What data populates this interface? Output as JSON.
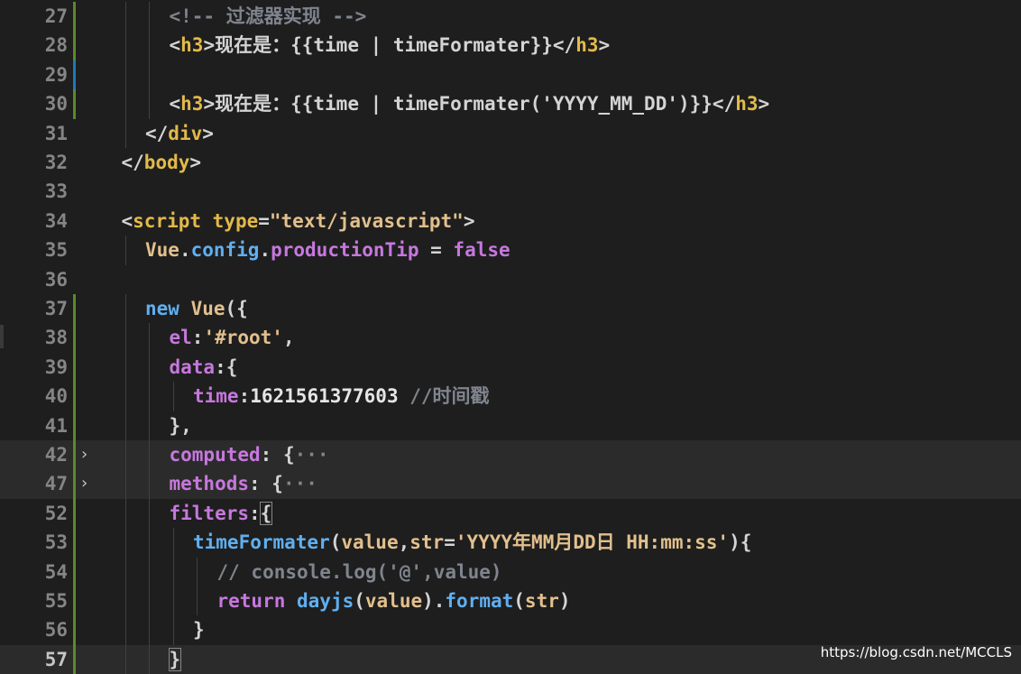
{
  "colors": {
    "background": "#1e1e1e",
    "highlight_line": "#2b2b2b",
    "line_number": "#858585",
    "tag": "#569cd6",
    "html_tag_name": "#e2b94a",
    "text": "#d4d4d4",
    "string": "#ce9178",
    "comment": "#7f848e",
    "keyword": "#569cd6",
    "property": "#c678dd",
    "number": "#b5cea8",
    "function": "#61afef"
  },
  "editor": {
    "lines": [
      {
        "num": "27",
        "indent": 3,
        "gutter": "modified",
        "tokens": [
          {
            "t": "<!-- 过滤器实现 -->",
            "c": "#7f848e"
          }
        ]
      },
      {
        "num": "28",
        "indent": 3,
        "gutter": "modified",
        "tokens": [
          {
            "t": "<",
            "c": "#d4d4d4"
          },
          {
            "t": "h3",
            "c": "#e2b94a"
          },
          {
            "t": ">",
            "c": "#d4d4d4"
          },
          {
            "t": "现在是：{{time | timeFormater}}",
            "c": "#d4d4d4"
          },
          {
            "t": "</",
            "c": "#d4d4d4"
          },
          {
            "t": "h3",
            "c": "#e2b94a"
          },
          {
            "t": ">",
            "c": "#d4d4d4"
          }
        ]
      },
      {
        "num": "29",
        "indent": 3,
        "gutter": "added",
        "tokens": []
      },
      {
        "num": "30",
        "indent": 3,
        "gutter": "modified",
        "tokens": [
          {
            "t": "<",
            "c": "#d4d4d4"
          },
          {
            "t": "h3",
            "c": "#e2b94a"
          },
          {
            "t": ">",
            "c": "#d4d4d4"
          },
          {
            "t": "现在是：{{time | timeFormater(",
            "c": "#d4d4d4"
          },
          {
            "t": "'YYYY_MM_DD'",
            "c": "#d4d4d4"
          },
          {
            "t": ")}}",
            "c": "#d4d4d4"
          },
          {
            "t": "</",
            "c": "#d4d4d4"
          },
          {
            "t": "h3",
            "c": "#e2b94a"
          },
          {
            "t": ">",
            "c": "#d4d4d4"
          }
        ]
      },
      {
        "num": "31",
        "indent": 2,
        "gutter": "",
        "tokens": [
          {
            "t": "</",
            "c": "#d4d4d4"
          },
          {
            "t": "div",
            "c": "#e2b94a"
          },
          {
            "t": ">",
            "c": "#d4d4d4"
          }
        ]
      },
      {
        "num": "32",
        "indent": 1,
        "gutter": "",
        "tokens": [
          {
            "t": "</",
            "c": "#d4d4d4"
          },
          {
            "t": "body",
            "c": "#e2b94a"
          },
          {
            "t": ">",
            "c": "#d4d4d4"
          }
        ]
      },
      {
        "num": "33",
        "indent": 0,
        "gutter": "",
        "tokens": []
      },
      {
        "num": "34",
        "indent": 1,
        "gutter": "",
        "tokens": [
          {
            "t": "<",
            "c": "#d4d4d4"
          },
          {
            "t": "script",
            "c": "#e2b94a"
          },
          {
            "t": " type",
            "c": "#e2b94a"
          },
          {
            "t": "=",
            "c": "#d4d4d4"
          },
          {
            "t": "\"text/javascript\"",
            "c": "#e2c08d"
          },
          {
            "t": ">",
            "c": "#d4d4d4"
          }
        ]
      },
      {
        "num": "35",
        "indent": 2,
        "gutter": "",
        "tokens": [
          {
            "t": "Vue",
            "c": "#e2c08d"
          },
          {
            "t": ".",
            "c": "#d4d4d4"
          },
          {
            "t": "config",
            "c": "#61afef"
          },
          {
            "t": ".",
            "c": "#d4d4d4"
          },
          {
            "t": "productionTip",
            "c": "#c678dd"
          },
          {
            "t": " = ",
            "c": "#d4d4d4"
          },
          {
            "t": "false",
            "c": "#c678dd"
          }
        ]
      },
      {
        "num": "36",
        "indent": 0,
        "gutter": "",
        "tokens": []
      },
      {
        "num": "37",
        "indent": 2,
        "gutter": "modified",
        "tokens": [
          {
            "t": "new ",
            "c": "#61afef"
          },
          {
            "t": "Vue",
            "c": "#e2c08d"
          },
          {
            "t": "({",
            "c": "#d4d4d4"
          }
        ]
      },
      {
        "num": "38",
        "indent": 3,
        "gutter": "modified",
        "tokens": [
          {
            "t": "el",
            "c": "#c678dd"
          },
          {
            "t": ":",
            "c": "#d4d4d4"
          },
          {
            "t": "'#root'",
            "c": "#e2c08d"
          },
          {
            "t": ",",
            "c": "#d4d4d4"
          }
        ]
      },
      {
        "num": "39",
        "indent": 3,
        "gutter": "modified",
        "tokens": [
          {
            "t": "data",
            "c": "#c678dd"
          },
          {
            "t": ":{",
            "c": "#d4d4d4"
          }
        ]
      },
      {
        "num": "40",
        "indent": 4,
        "gutter": "modified",
        "tokens": [
          {
            "t": "time",
            "c": "#c678dd"
          },
          {
            "t": ":",
            "c": "#d4d4d4"
          },
          {
            "t": "1621561377603",
            "c": "#e5e5e5"
          },
          {
            "t": " //时间戳",
            "c": "#7f848e"
          }
        ]
      },
      {
        "num": "41",
        "indent": 3,
        "gutter": "modified",
        "tokens": [
          {
            "t": "},",
            "c": "#d4d4d4"
          }
        ]
      },
      {
        "num": "42",
        "indent": 3,
        "gutter": "modified",
        "fold": true,
        "highlight": true,
        "tokens": [
          {
            "t": "computed",
            "c": "#c678dd"
          },
          {
            "t": ": {",
            "c": "#d4d4d4"
          },
          {
            "t": "···",
            "c": "#858585"
          }
        ]
      },
      {
        "num": "47",
        "indent": 3,
        "gutter": "modified",
        "fold": true,
        "highlight": true,
        "tokens": [
          {
            "t": "methods",
            "c": "#c678dd"
          },
          {
            "t": ": {",
            "c": "#d4d4d4"
          },
          {
            "t": "···",
            "c": "#858585"
          }
        ]
      },
      {
        "num": "52",
        "indent": 3,
        "gutter": "modified",
        "tokens": [
          {
            "t": "filters",
            "c": "#c678dd"
          },
          {
            "t": ":",
            "c": "#d4d4d4"
          },
          {
            "t": "{",
            "c": "#d4d4d4",
            "box": true
          }
        ]
      },
      {
        "num": "53",
        "indent": 4,
        "gutter": "modified",
        "tokens": [
          {
            "t": "timeFormater",
            "c": "#61afef"
          },
          {
            "t": "(",
            "c": "#d4d4d4"
          },
          {
            "t": "value",
            "c": "#e2c08d"
          },
          {
            "t": ",",
            "c": "#d4d4d4"
          },
          {
            "t": "str",
            "c": "#e2c08d"
          },
          {
            "t": "=",
            "c": "#d4d4d4"
          },
          {
            "t": "'YYYY年MM月DD日 HH:mm:ss'",
            "c": "#e2c08d"
          },
          {
            "t": "){",
            "c": "#d4d4d4"
          }
        ]
      },
      {
        "num": "54",
        "indent": 5,
        "gutter": "modified",
        "tokens": [
          {
            "t": "// console.log('@',value)",
            "c": "#7f848e"
          }
        ]
      },
      {
        "num": "55",
        "indent": 5,
        "gutter": "modified",
        "tokens": [
          {
            "t": "return ",
            "c": "#c678dd"
          },
          {
            "t": "dayjs",
            "c": "#61afef"
          },
          {
            "t": "(",
            "c": "#d4d4d4"
          },
          {
            "t": "value",
            "c": "#e2c08d"
          },
          {
            "t": ").",
            "c": "#d4d4d4"
          },
          {
            "t": "format",
            "c": "#61afef"
          },
          {
            "t": "(",
            "c": "#d4d4d4"
          },
          {
            "t": "str",
            "c": "#e2c08d"
          },
          {
            "t": ")",
            "c": "#d4d4d4"
          }
        ]
      },
      {
        "num": "56",
        "indent": 4,
        "gutter": "modified",
        "tokens": [
          {
            "t": "}",
            "c": "#d4d4d4"
          }
        ]
      },
      {
        "num": "57",
        "indent": 3,
        "gutter": "modified",
        "current": true,
        "highlight": true,
        "tokens": [
          {
            "t": "}",
            "c": "#d4d4d4",
            "box": true
          }
        ]
      }
    ]
  },
  "watermark": "https://blog.csdn.net/MCCLS"
}
